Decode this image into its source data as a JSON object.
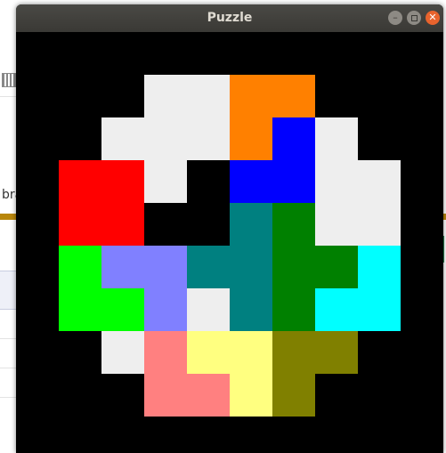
{
  "window": {
    "title": "Puzzle"
  },
  "background_app": {
    "left_text": "bra"
  },
  "controls": {
    "minimize_icon": "minimize-icon",
    "maximize_icon": "maximize-icon",
    "close_icon": "close-icon"
  },
  "colors": {
    "background": "#000000",
    "white": "#eeeeee",
    "orange": "#ff8000",
    "blue": "#0000ff",
    "red": "#ff0000",
    "teal": "#008080",
    "green": "#008000",
    "lime": "#00ff00",
    "periwinkle": "#8080ff",
    "cyan": "#00ffff",
    "pink": "#ff8080",
    "yellow": "#ffff80",
    "olive": "#808000"
  },
  "grid": {
    "columns": 8,
    "rows": 8,
    "cells": [
      [
        null,
        null,
        "white",
        "white",
        "orange",
        "orange",
        null,
        null
      ],
      [
        null,
        "white",
        "white",
        "white",
        "orange",
        "blue",
        "white",
        null
      ],
      [
        "red",
        "red",
        "white",
        null,
        "blue",
        "blue",
        "white",
        "white"
      ],
      [
        "red",
        "red",
        null,
        null,
        "teal",
        "green",
        "white",
        "white"
      ],
      [
        "lime",
        "periwinkle",
        "periwinkle",
        "teal",
        "teal",
        "green",
        "green",
        "cyan"
      ],
      [
        "lime",
        "lime",
        "periwinkle",
        "white",
        "teal",
        "green",
        "cyan",
        "cyan"
      ],
      [
        null,
        "white",
        "pink",
        "yellow",
        "yellow",
        "olive",
        "olive",
        null
      ],
      [
        null,
        null,
        "pink",
        "pink",
        "yellow",
        "olive",
        null,
        null
      ]
    ]
  }
}
